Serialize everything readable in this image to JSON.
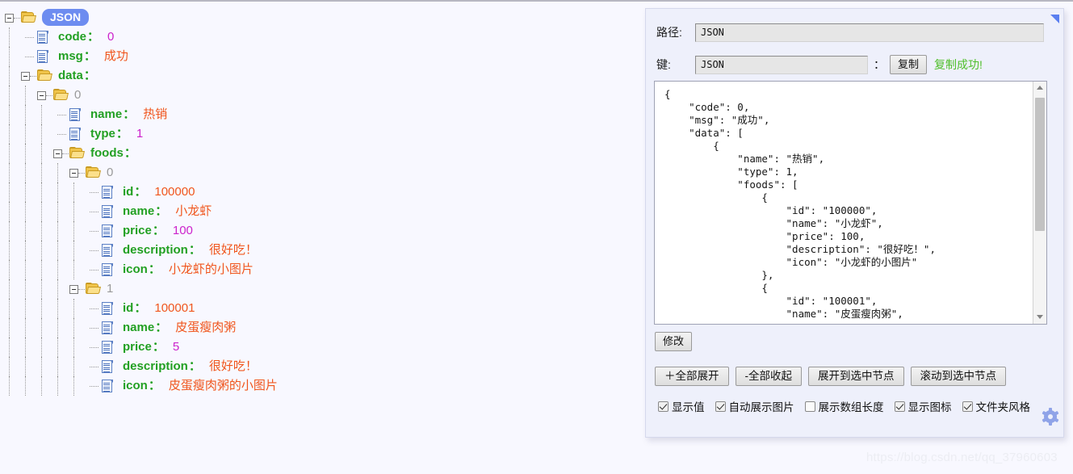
{
  "watermark": "https://blog.csdn.net/qq_37960603",
  "tree": {
    "root_label": "JSON",
    "rows": [
      {
        "depth": 0,
        "icon": "folder-icon",
        "toggle": true,
        "label": "JSON",
        "label_kind": "badge",
        "value": "",
        "value_kind": "none"
      },
      {
        "depth": 1,
        "icon": "file-icon",
        "toggle": false,
        "label": "code",
        "label_kind": "key",
        "value": "0",
        "value_kind": "num"
      },
      {
        "depth": 1,
        "icon": "file-icon",
        "toggle": false,
        "label": "msg",
        "label_kind": "key",
        "value": "成功",
        "value_kind": "str"
      },
      {
        "depth": 1,
        "icon": "folder-icon",
        "toggle": true,
        "label": "data",
        "label_kind": "key",
        "value": "",
        "value_kind": "none"
      },
      {
        "depth": 2,
        "icon": "folder-icon",
        "toggle": true,
        "label": "0",
        "label_kind": "index",
        "value": "",
        "value_kind": "none"
      },
      {
        "depth": 3,
        "icon": "file-icon",
        "toggle": false,
        "label": "name",
        "label_kind": "key",
        "value": "热销",
        "value_kind": "str"
      },
      {
        "depth": 3,
        "icon": "file-icon",
        "toggle": false,
        "label": "type",
        "label_kind": "key",
        "value": "1",
        "value_kind": "num"
      },
      {
        "depth": 3,
        "icon": "folder-icon",
        "toggle": true,
        "label": "foods",
        "label_kind": "key",
        "value": "",
        "value_kind": "none"
      },
      {
        "depth": 4,
        "icon": "folder-icon",
        "toggle": true,
        "label": "0",
        "label_kind": "index",
        "value": "",
        "value_kind": "none"
      },
      {
        "depth": 5,
        "icon": "file-icon",
        "toggle": false,
        "label": "id",
        "label_kind": "key",
        "value": "100000",
        "value_kind": "str"
      },
      {
        "depth": 5,
        "icon": "file-icon",
        "toggle": false,
        "label": "name",
        "label_kind": "key",
        "value": "小龙虾",
        "value_kind": "str"
      },
      {
        "depth": 5,
        "icon": "file-icon",
        "toggle": false,
        "label": "price",
        "label_kind": "key",
        "value": "100",
        "value_kind": "num"
      },
      {
        "depth": 5,
        "icon": "file-icon",
        "toggle": false,
        "label": "description",
        "label_kind": "key",
        "value": "很好吃！",
        "value_kind": "str"
      },
      {
        "depth": 5,
        "icon": "file-icon",
        "toggle": false,
        "label": "icon",
        "label_kind": "key",
        "value": "小龙虾的小图片",
        "value_kind": "str"
      },
      {
        "depth": 4,
        "icon": "folder-icon",
        "toggle": true,
        "label": "1",
        "label_kind": "index",
        "value": "",
        "value_kind": "none"
      },
      {
        "depth": 5,
        "icon": "file-icon",
        "toggle": false,
        "label": "id",
        "label_kind": "key",
        "value": "100001",
        "value_kind": "str"
      },
      {
        "depth": 5,
        "icon": "file-icon",
        "toggle": false,
        "label": "name",
        "label_kind": "key",
        "value": "皮蛋瘦肉粥",
        "value_kind": "str"
      },
      {
        "depth": 5,
        "icon": "file-icon",
        "toggle": false,
        "label": "price",
        "label_kind": "key",
        "value": "5",
        "value_kind": "num"
      },
      {
        "depth": 5,
        "icon": "file-icon",
        "toggle": false,
        "label": "description",
        "label_kind": "key",
        "value": "很好吃！",
        "value_kind": "str"
      },
      {
        "depth": 5,
        "icon": "file-icon",
        "toggle": false,
        "label": "icon",
        "label_kind": "key",
        "value": "皮蛋瘦肉粥的小图片",
        "value_kind": "str"
      }
    ]
  },
  "panel": {
    "path_label": "路径:",
    "path_value": "JSON",
    "key_label": "键:",
    "key_value": "JSON",
    "key_colon": "：",
    "copy_button": "复制",
    "copy_status": "复制成功!",
    "json_text": "{\n    \"code\": 0,\n    \"msg\": \"成功\",\n    \"data\": [\n        {\n            \"name\": \"热销\",\n            \"type\": 1,\n            \"foods\": [\n                {\n                    \"id\": \"100000\",\n                    \"name\": \"小龙虾\",\n                    \"price\": 100,\n                    \"description\": \"很好吃！\",\n                    \"icon\": \"小龙虾的小图片\"\n                },\n                {\n                    \"id\": \"100001\",\n                    \"name\": \"皮蛋瘦肉粥\",",
    "modify_button": "修改",
    "actions": [
      "＋全部展开",
      "-全部收起",
      "展开到选中节点",
      "滚动到选中节点"
    ],
    "checkboxes": [
      {
        "label": "显示值",
        "checked": true
      },
      {
        "label": "自动展示图片",
        "checked": true
      },
      {
        "label": "展示数组长度",
        "checked": false
      },
      {
        "label": "显示图标",
        "checked": true
      },
      {
        "label": "文件夹风格",
        "checked": true
      }
    ]
  },
  "colors": {
    "key": "#22a022",
    "string": "#f0561d",
    "number": "#cc22cc",
    "badge": "#6d8cf0",
    "success": "#4fbf2a"
  }
}
